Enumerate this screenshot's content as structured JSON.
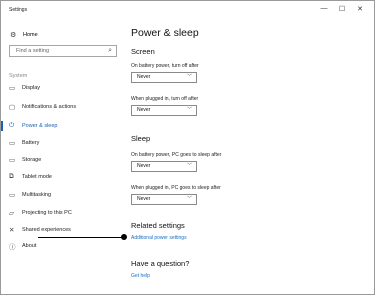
{
  "window": {
    "title": "Settings",
    "minimize": "—",
    "maximize": "☐",
    "close": "✕"
  },
  "sidebar": {
    "home_label": "Home",
    "search_placeholder": "Find a setting",
    "section_label": "System",
    "items": [
      {
        "label": "Display",
        "icon": "display-icon"
      },
      {
        "label": "Notifications & actions",
        "icon": "notifications-icon"
      },
      {
        "label": "Power & sleep",
        "icon": "power-icon",
        "active": true
      },
      {
        "label": "Battery",
        "icon": "battery-icon"
      },
      {
        "label": "Storage",
        "icon": "storage-icon"
      },
      {
        "label": "Tablet mode",
        "icon": "tablet-mode-icon"
      },
      {
        "label": "Multitasking",
        "icon": "multitasking-icon"
      },
      {
        "label": "Projecting to this PC",
        "icon": "projecting-icon"
      },
      {
        "label": "Shared experiences",
        "icon": "shared-experiences-icon"
      },
      {
        "label": "About",
        "icon": "info-icon"
      }
    ]
  },
  "main": {
    "title": "Power & sleep",
    "screen": {
      "heading": "Screen",
      "battery_label": "On battery power, turn off after",
      "battery_value": "Never",
      "plugged_label": "When plugged in, turn off after",
      "plugged_value": "Never"
    },
    "sleep": {
      "heading": "Sleep",
      "battery_label": "On battery power, PC goes to sleep after",
      "battery_value": "Never",
      "plugged_label": "When plugged in, PC goes to sleep after",
      "plugged_value": "Never"
    },
    "related": {
      "heading": "Related settings",
      "link": "Additional power settings"
    },
    "question": {
      "heading": "Have a question?",
      "link": "Get help"
    }
  },
  "colors": {
    "accent": "#1a5fb4",
    "link": "#1a6fc4"
  }
}
